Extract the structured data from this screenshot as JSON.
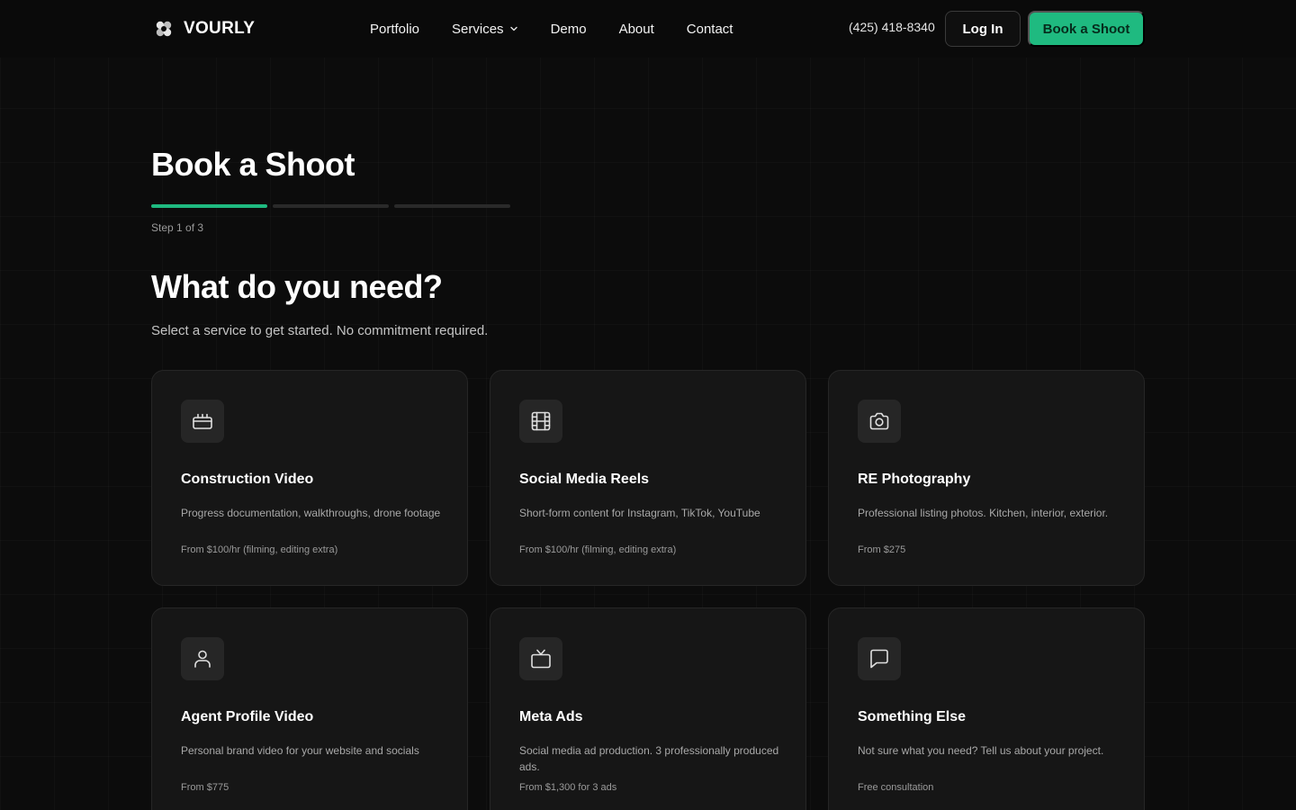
{
  "header": {
    "brand_name": "VOURLY",
    "nav": [
      {
        "label": "Portfolio"
      },
      {
        "label": "Services"
      },
      {
        "label": "Demo"
      },
      {
        "label": "About"
      },
      {
        "label": "Contact"
      }
    ],
    "phone": "(425) 418-8340",
    "login_label": "Log In",
    "book_label": "Book a Shoot"
  },
  "main": {
    "title": "Book a Shoot",
    "step": {
      "current": 1,
      "total": 3,
      "text": "Step 1 of 3"
    },
    "question": "What do you need?",
    "subtitle": "Select a service to get started. No commitment required.",
    "services": [
      {
        "icon": "clapperboard-icon",
        "title": "Construction Video",
        "description": "Progress documentation, walkthroughs, drone footage",
        "price": "From $100/hr (filming, editing extra)"
      },
      {
        "icon": "film-icon",
        "title": "Social Media Reels",
        "description": "Short-form content for Instagram, TikTok, YouTube",
        "price": "From $100/hr (filming, editing extra)"
      },
      {
        "icon": "camera-icon",
        "title": "RE Photography",
        "description": "Professional listing photos. Kitchen, interior, exterior.",
        "price": "From $275"
      },
      {
        "icon": "user-icon",
        "title": "Agent Profile Video",
        "description": "Personal brand video for your website and socials",
        "price": "From $775"
      },
      {
        "icon": "tv-icon",
        "title": "Meta Ads",
        "description": "Social media ad production. 3 professionally produced ads.",
        "price": "From $1,300 for 3 ads"
      },
      {
        "icon": "chat-bubble-icon",
        "title": "Something Else",
        "description": "Not sure what you need? Tell us about your project.",
        "price": "Free consultation"
      }
    ]
  },
  "colors": {
    "accent": "#1fba80",
    "background": "#0c0c0c",
    "card": "#161616"
  }
}
